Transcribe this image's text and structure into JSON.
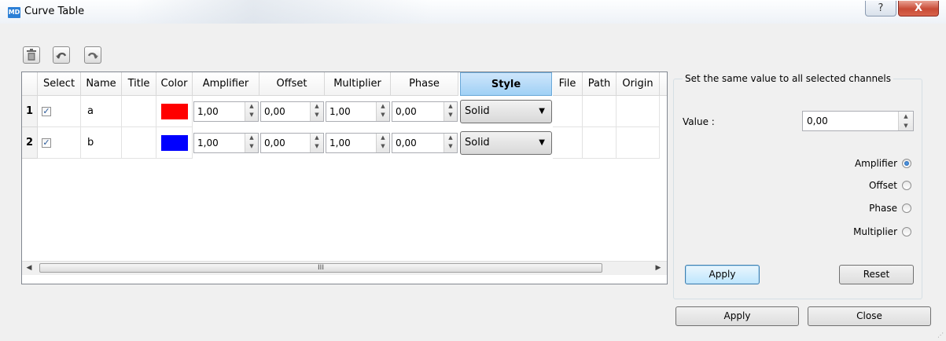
{
  "window": {
    "icon_text": "MD",
    "title": "Curve Table",
    "help_glyph": "?",
    "close_glyph": "X"
  },
  "toolbar": {
    "items": [
      {
        "name": "delete",
        "icon": "trash-icon"
      },
      {
        "name": "undo",
        "icon": "undo-icon"
      },
      {
        "name": "redo",
        "icon": "redo-icon"
      }
    ]
  },
  "table": {
    "columns": [
      "Select",
      "Name",
      "Title",
      "Color",
      "Amplifier",
      "Offset",
      "Multiplier",
      "Phase",
      "Style",
      "File",
      "Path",
      "Origin"
    ],
    "active_column": "Style",
    "rows": [
      {
        "index": "1",
        "checked": true,
        "name": "a",
        "title": "",
        "color": "#ff0000",
        "amplifier": "1,00",
        "offset": "0,00",
        "multiplier": "1,00",
        "phase": "0,00",
        "style": "Solid",
        "file": "",
        "path": "",
        "origin": ""
      },
      {
        "index": "2",
        "checked": true,
        "name": "b",
        "title": "",
        "color": "#0000ff",
        "amplifier": "1,00",
        "offset": "0,00",
        "multiplier": "1,00",
        "phase": "0,00",
        "style": "Solid",
        "file": "",
        "path": "",
        "origin": ""
      }
    ],
    "scroll_grip": "III"
  },
  "panel": {
    "title": "Set the same value to all selected channels",
    "value_label": "Value :",
    "value": "0,00",
    "radios": [
      {
        "label": "Amplifier",
        "selected": true
      },
      {
        "label": "Offset",
        "selected": false
      },
      {
        "label": "Phase",
        "selected": false
      },
      {
        "label": "Multiplier",
        "selected": false
      }
    ],
    "apply_label": "Apply",
    "reset_label": "Reset"
  },
  "footer": {
    "apply_label": "Apply",
    "close_label": "Close"
  }
}
